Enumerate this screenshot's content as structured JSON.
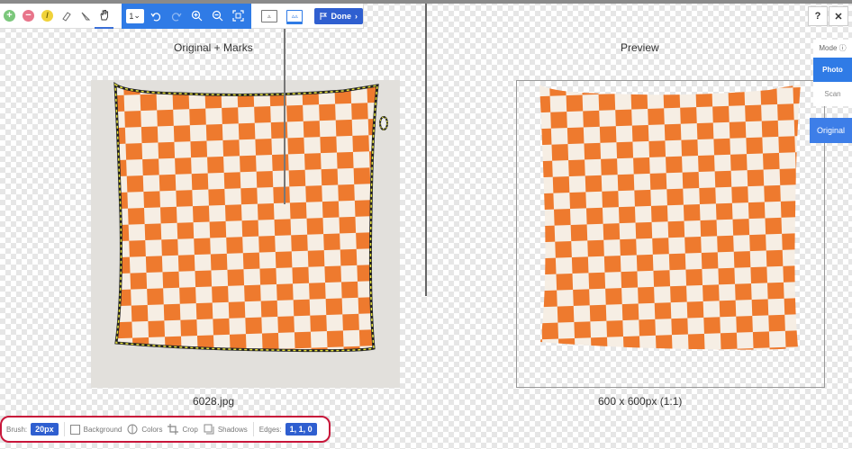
{
  "toolbar": {
    "done_label": "Done",
    "brush_size_value": "1"
  },
  "panels": {
    "original_title": "Original + Marks",
    "preview_title": "Preview"
  },
  "images": {
    "original_filename": "6028.jpg",
    "preview_size": "600 x 600px (1:1)"
  },
  "side": {
    "help_label": "?",
    "close_label": "✕",
    "mode_label": "Mode ⓘ",
    "modes": [
      "Photo",
      "Scan"
    ],
    "original_toggle": "Original"
  },
  "bottom": {
    "brush_label": "Brush:",
    "brush_value": "20px",
    "background_label": "Background",
    "colors_label": "Colors",
    "crop_label": "Crop",
    "shadows_label": "Shadows",
    "edges_label": "Edges:",
    "edges_value": "1, 1, 0"
  },
  "colors": {
    "accent": "#2f7be6",
    "pillow_orange": "#ee7a2e",
    "pillow_cream": "#f6eee4",
    "highlight_border": "#c8163a"
  }
}
